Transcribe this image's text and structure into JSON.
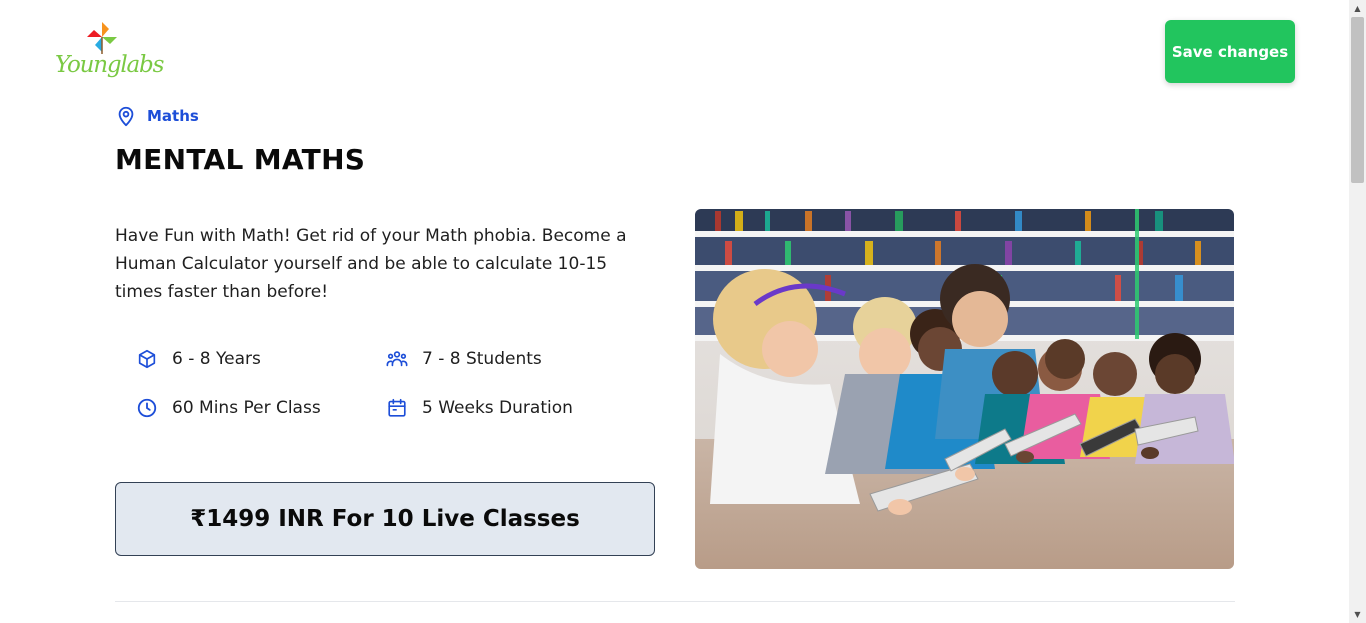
{
  "brand": {
    "name": "Younglabs"
  },
  "header": {
    "save_label": "Save changes"
  },
  "course": {
    "category": "Maths",
    "title": "MENTAL MATHS",
    "description": "Have Fun with Math! Get rid of your Math phobia. Become a Human Calculator yourself and be able to calculate 10-15 times faster than before!",
    "features": {
      "age": "6 - 8 Years",
      "students": "7 - 8 Students",
      "duration_per_class": "60 Mins Per Class",
      "weeks": "5 Weeks Duration"
    },
    "price": "₹1499 INR For 10 Live Classes"
  },
  "icons": {
    "category": "map-pin-icon",
    "age": "cube-icon",
    "students": "user-group-icon",
    "class_time": "clock-icon",
    "weeks": "calendar-icon"
  },
  "colors": {
    "accent_blue": "#1d4ed8",
    "save_green": "#22c55e",
    "price_bg": "#e2e8f0",
    "brand_green": "#7ac943"
  }
}
